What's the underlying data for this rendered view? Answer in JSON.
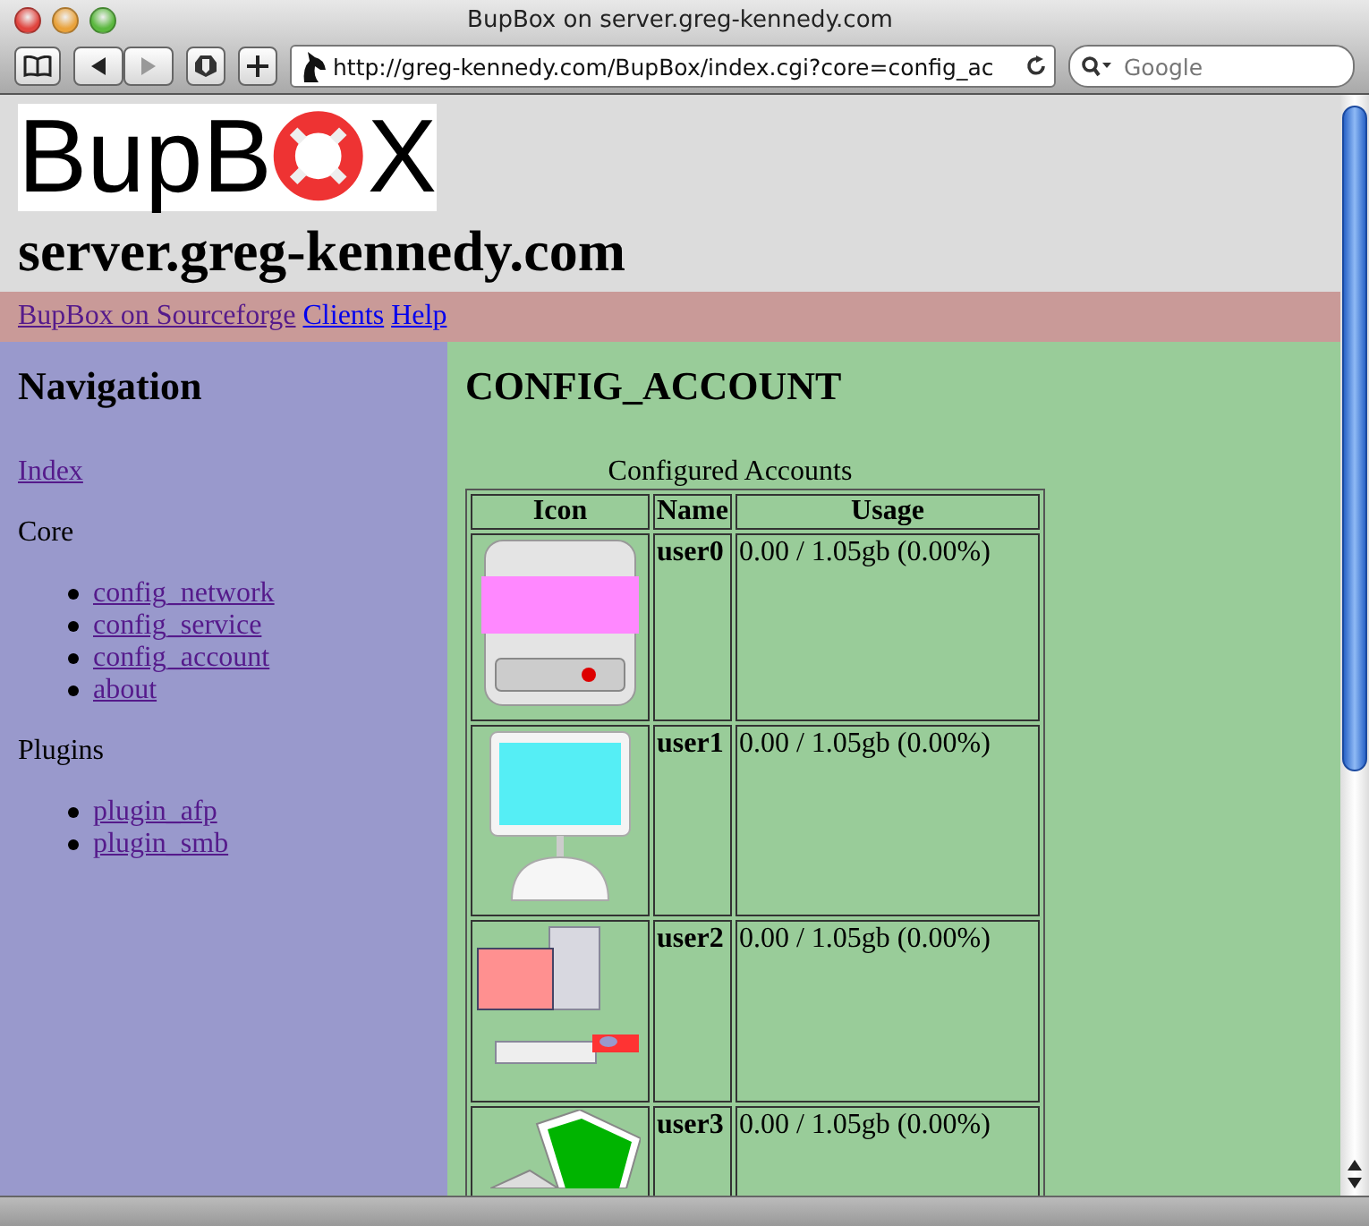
{
  "window": {
    "title": "BupBox on server.greg-kennedy.com"
  },
  "toolbar": {
    "url": "http://greg-kennedy.com/BupBox/index.cgi?core=config_ac",
    "search_placeholder": "Google"
  },
  "header": {
    "logo": {
      "before": "BupB",
      "after": "X"
    },
    "title": "server.greg-kennedy.com"
  },
  "top_links": [
    {
      "label": "BupBox on Sourceforge",
      "visited": true
    },
    {
      "label": "Clients",
      "visited": false
    },
    {
      "label": "Help",
      "visited": false
    }
  ],
  "sidebar": {
    "title": "Navigation",
    "index": {
      "label": "Index",
      "visited": true
    },
    "sections": [
      {
        "label": "Core",
        "items": [
          {
            "label": "config_network",
            "visited": true
          },
          {
            "label": "config_service",
            "visited": true
          },
          {
            "label": "config_account",
            "visited": true
          },
          {
            "label": "about",
            "visited": true
          }
        ]
      },
      {
        "label": "Plugins",
        "items": [
          {
            "label": "plugin_afp",
            "visited": true
          },
          {
            "label": "plugin_smb",
            "visited": true
          }
        ]
      }
    ]
  },
  "main": {
    "title": "CONFIG_ACCOUNT",
    "table": {
      "caption": "Configured Accounts",
      "columns": [
        "Icon",
        "Name",
        "Usage"
      ],
      "rows": [
        {
          "icon": {
            "kind": "drive"
          },
          "name": "user0",
          "usage": "0.00 / 1.05gb (0.00%)"
        },
        {
          "icon": {
            "kind": "imac"
          },
          "name": "user1",
          "usage": "0.00 / 1.05gb (0.00%)"
        },
        {
          "icon": {
            "kind": "desktop"
          },
          "name": "user2",
          "usage": "0.00 / 1.05gb (0.00%)"
        },
        {
          "icon": {
            "kind": "laptop"
          },
          "name": "user3",
          "usage": "0.00 / 1.05gb (0.00%)"
        }
      ]
    }
  }
}
